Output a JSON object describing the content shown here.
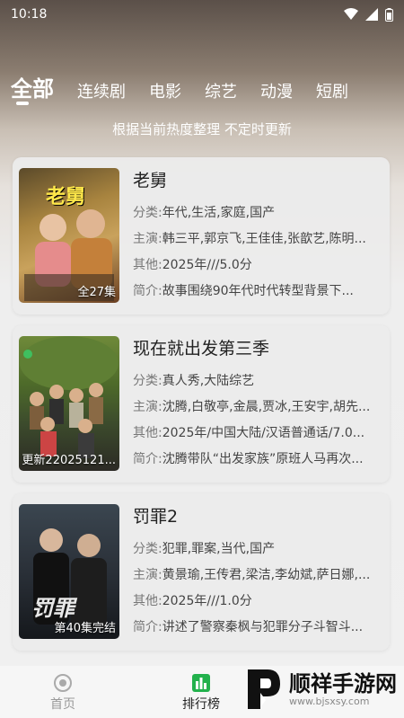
{
  "status": {
    "time": "10:18"
  },
  "tabs": [
    "全部",
    "连续剧",
    "电影",
    "综艺",
    "动漫",
    "短剧"
  ],
  "notice": "根据当前热度整理 不定时更新",
  "items": [
    {
      "title": "老舅",
      "category_k": "分类:",
      "category_v": "年代,生活,家庭,国产",
      "cast_k": "主演:",
      "cast_v": "韩三平,郭京飞,王佳佳,张歆艺,陈明...",
      "other_k": "其他:",
      "other_v": "2025年///5.0分",
      "intro_k": "简介:",
      "intro_v": "故事围绕90年代时代转型背景下...",
      "badge": "全27集",
      "poster_text": "老舅"
    },
    {
      "title": "现在就出发第三季",
      "category_k": "分类:",
      "category_v": "真人秀,大陆综艺",
      "cast_k": "主演:",
      "cast_v": "沈腾,白敬亭,金晨,贾冰,王安宇,胡先...",
      "other_k": "其他:",
      "other_v": "2025年/中国大陆/汉语普通话/7.0...",
      "intro_k": "简介:",
      "intro_v": "沈腾带队“出发家族”原班人马再次...",
      "badge": "更新22025121...",
      "poster_text": ""
    },
    {
      "title": "罚罪2",
      "category_k": "分类:",
      "category_v": "犯罪,罪案,当代,国产",
      "cast_k": "主演:",
      "cast_v": "黄景瑜,王传君,梁洁,李幼斌,萨日娜,...",
      "other_k": "其他:",
      "other_v": "2025年///1.0分",
      "intro_k": "简介:",
      "intro_v": "讲述了警察秦枫与犯罪分子斗智斗...",
      "badge": "第40集完结",
      "poster_text": "罚罪"
    }
  ],
  "bottom_nav": {
    "home": "首页",
    "ranking": "排行榜"
  },
  "watermark": {
    "name": "顺祥手游网",
    "url": "www.bjsxsy.com"
  },
  "colors": {
    "accent": "#ffffff",
    "card": "#ebebeb",
    "ranking_icon": "#22b14c"
  }
}
